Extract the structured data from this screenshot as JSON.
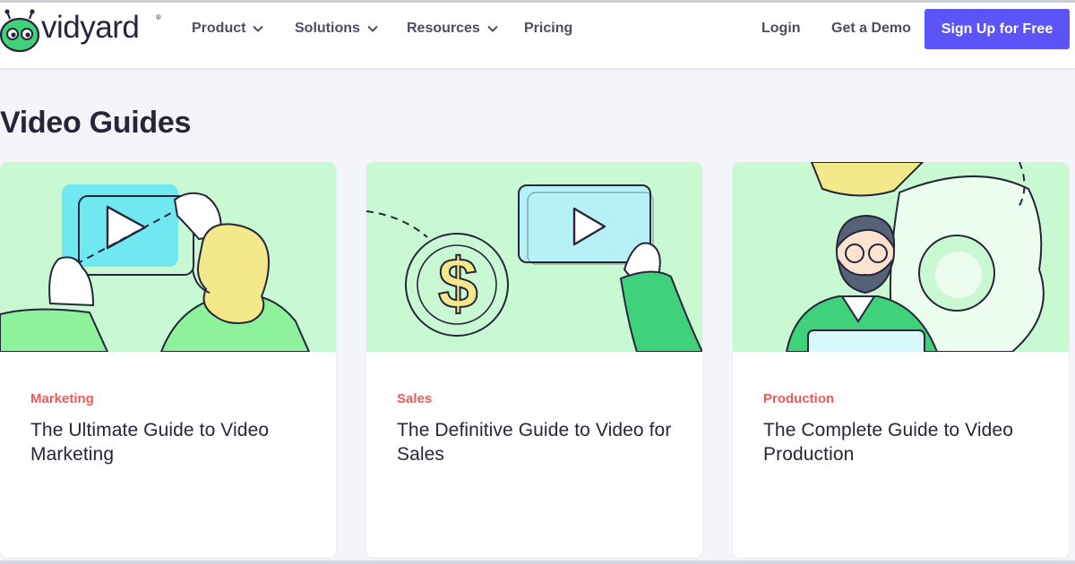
{
  "header": {
    "logo_text": "vidyard",
    "logo_mark": "®",
    "nav_items": [
      {
        "label": "Product",
        "has_dropdown": true
      },
      {
        "label": "Solutions",
        "has_dropdown": true
      },
      {
        "label": "Resources",
        "has_dropdown": true
      },
      {
        "label": "Pricing",
        "has_dropdown": false
      }
    ],
    "login_label": "Login",
    "demo_label": "Get a Demo",
    "signup_label": "Sign Up for Free"
  },
  "page": {
    "title": "Video Guides"
  },
  "cards": [
    {
      "category": "Marketing",
      "title": "The Ultimate Guide to Video Marketing",
      "illustration": "woman-pointing-video-player-illustration"
    },
    {
      "category": "Sales",
      "title": "The Definitive Guide to Video for Sales",
      "illustration": "dollar-coin-video-player-illustration"
    },
    {
      "category": "Production",
      "title": "The Complete Guide to Video Production",
      "illustration": "man-with-gears-laptop-illustration"
    }
  ],
  "colors": {
    "accent": "#5a54f9",
    "category": "#ef5a58",
    "card_art_bg": "#c9f9d2",
    "logo_green": "#3fd27a",
    "text": "#27253a"
  }
}
